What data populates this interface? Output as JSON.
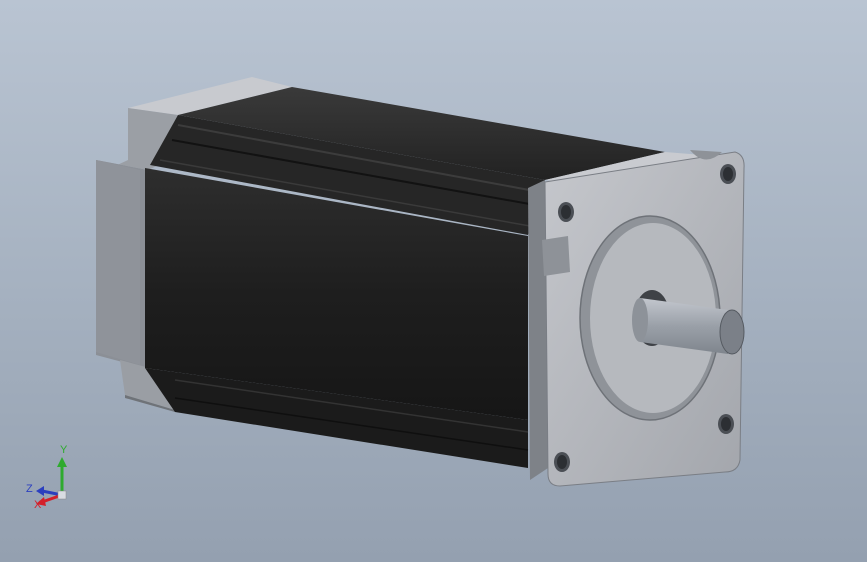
{
  "viewport": {
    "background_top": "#b9c4d2",
    "background_bottom": "#94a0b0"
  },
  "model": {
    "body_color": "#1f1f1f",
    "flange_color": "#b3b5ba",
    "endcap_color": "#8f9399",
    "shaft_color": "#9ea3ab"
  },
  "triad": {
    "x_label": "X",
    "y_label": "Y",
    "z_label": "Z",
    "x_color": "#d4202a",
    "y_color": "#2faa2f",
    "z_color": "#2b3fbf"
  }
}
